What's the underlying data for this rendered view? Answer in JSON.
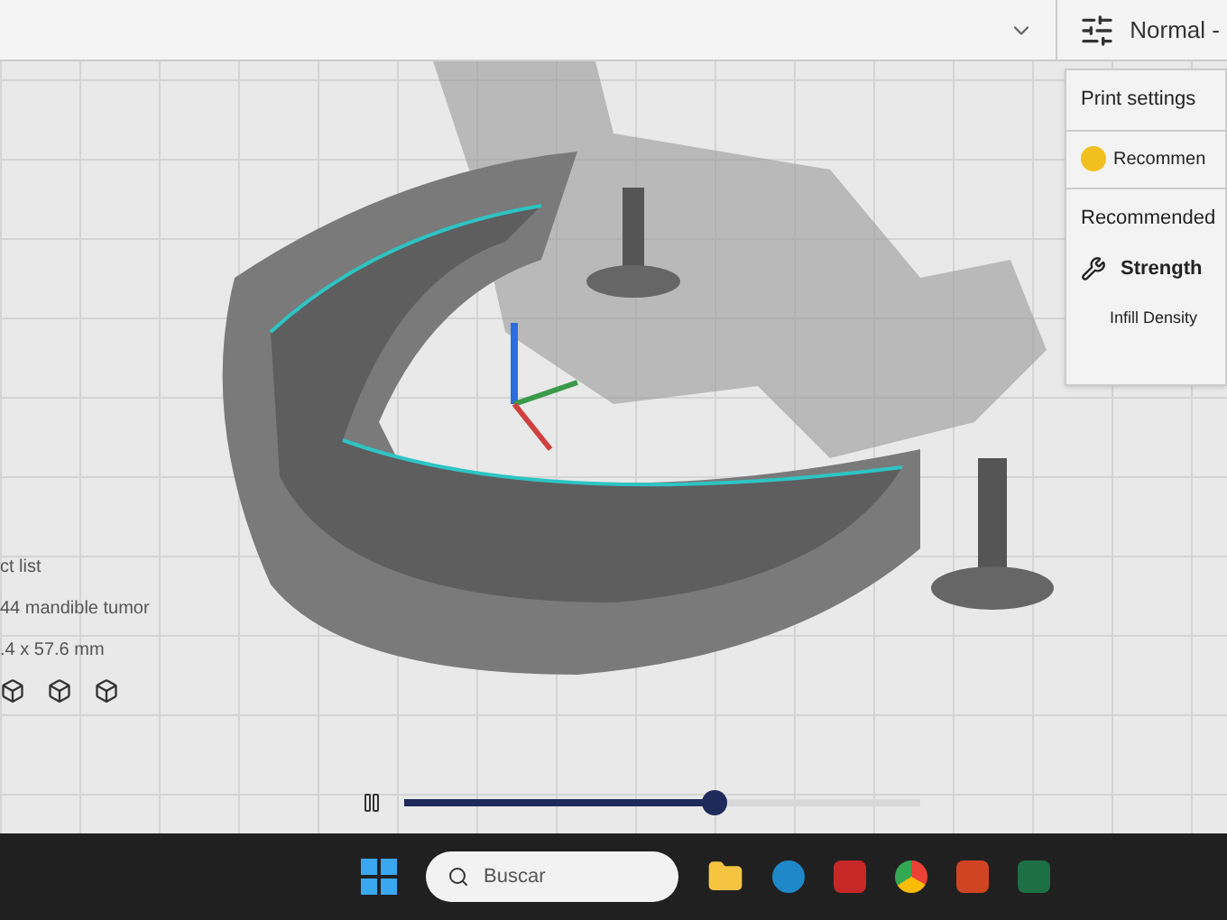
{
  "top_bar": {
    "profile": "Normal -"
  },
  "print_settings": {
    "title": "Print settings",
    "warning": "Recommen",
    "section": "Recommended",
    "strength": "Strength",
    "infill_label": "Infill Density"
  },
  "object_list": {
    "title": "ct list",
    "object_name": "44 mandible tumor",
    "dimensions": ".4 x 57.6 mm"
  },
  "layer_slider": {
    "level": 0.6,
    "playing": true
  },
  "taskbar": {
    "search_placeholder": "Buscar"
  }
}
